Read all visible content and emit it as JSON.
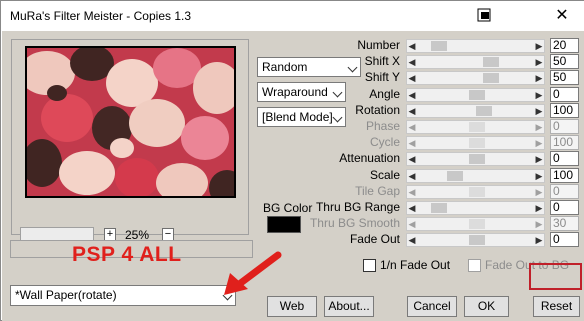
{
  "window": {
    "title": "MuRa's Filter Meister - Copies 1.3",
    "close_glyph": "✕"
  },
  "preview": {
    "zoom_percent": "25%",
    "zoom_plus": "+",
    "zoom_minus": "−"
  },
  "overlay_text": "PSP 4 ALL",
  "dropdowns": {
    "mode": "Random",
    "edge": "Wraparound",
    "blend": "[Blend Mode]",
    "preset": "*Wall Paper(rotate)"
  },
  "bg_color": {
    "label": "BG Color",
    "value": "#000000"
  },
  "params": [
    {
      "label": "Number",
      "value": "20",
      "fraction": 0.14,
      "enabled": true
    },
    {
      "label": "Shift X",
      "value": "50",
      "fraction": 0.64,
      "enabled": true
    },
    {
      "label": "Shift Y",
      "value": "50",
      "fraction": 0.64,
      "enabled": true
    },
    {
      "label": "Angle",
      "value": "0",
      "fraction": 0.5,
      "enabled": true
    },
    {
      "label": "Rotation",
      "value": "100",
      "fraction": 0.57,
      "enabled": true
    },
    {
      "label": "Phase",
      "value": "0",
      "fraction": 0.5,
      "enabled": false
    },
    {
      "label": "Cycle",
      "value": "100",
      "fraction": 0.5,
      "enabled": false
    },
    {
      "label": "Attenuation",
      "value": "0",
      "fraction": 0.5,
      "enabled": true
    },
    {
      "label": "Scale",
      "value": "100",
      "fraction": 0.29,
      "enabled": true
    },
    {
      "label": "Tile Gap",
      "value": "0",
      "fraction": 0.5,
      "enabled": false
    },
    {
      "label": "Thru BG Range",
      "value": "0",
      "fraction": 0.14,
      "enabled": true
    },
    {
      "label": "Thru BG Smooth",
      "value": "30",
      "fraction": 0.5,
      "enabled": false
    },
    {
      "label": "Fade Out",
      "value": "0",
      "fraction": 0.5,
      "enabled": true
    }
  ],
  "checkboxes": {
    "fade_1n": {
      "label": "1/n Fade Out",
      "checked": false
    },
    "fade_bg": {
      "label": "Fade Out to BG",
      "checked": false
    }
  },
  "buttons": {
    "web": "Web",
    "about": "About...",
    "cancel": "Cancel",
    "ok": "OK",
    "reset": "Reset"
  },
  "colors": {
    "dialog_bg": "#d4d0c8",
    "highlight": "#c0202a",
    "overlay_text": "#e0201c"
  }
}
